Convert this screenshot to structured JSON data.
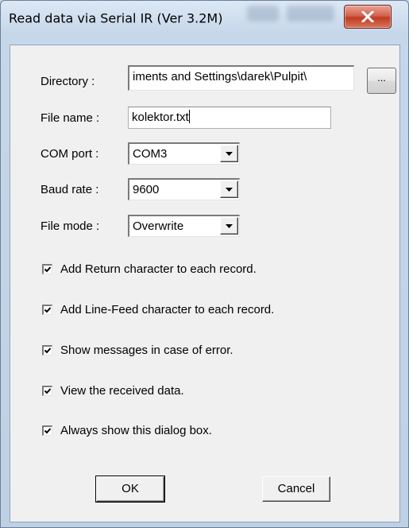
{
  "window": {
    "title": "Read data via Serial IR (Ver 3.2M)"
  },
  "fields": {
    "directory_label": "Directory :",
    "directory_value": "iments and Settings\\darek\\Pulpit\\",
    "browse_label": "...",
    "filename_label": "File name :",
    "filename_value": "kolektor.txt",
    "comport_label": "COM port :",
    "comport_value": "COM3",
    "baudrate_label": "Baud rate :",
    "baudrate_value": "9600",
    "filemode_label": "File mode :",
    "filemode_value": "Overwrite"
  },
  "options": [
    {
      "label": "Add Return character to each record.",
      "checked": true
    },
    {
      "label": "Add Line-Feed character to each record.",
      "checked": true
    },
    {
      "label": "Show messages in case of error.",
      "checked": true
    },
    {
      "label": "View the received data.",
      "checked": true
    },
    {
      "label": "Always show this dialog box.",
      "checked": true
    }
  ],
  "buttons": {
    "ok_label": "OK",
    "cancel_label": "Cancel"
  },
  "colors": {
    "close_button": "#c84a32",
    "dialog_background": "#f0f0f0",
    "frame": "#c7d7ea"
  }
}
